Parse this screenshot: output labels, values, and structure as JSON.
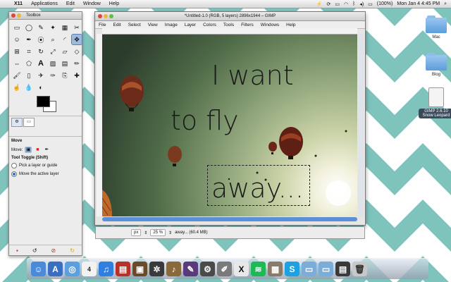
{
  "menubar": {
    "app": "X11",
    "items": [
      "Applications",
      "Edit",
      "Window",
      "Help"
    ],
    "battery": "(100%)",
    "clock": "Mon Jan 4  4:45 PM"
  },
  "toolbox": {
    "title": "Toolbox",
    "tool_options": {
      "heading": "Move",
      "move_label": "Move:",
      "toggle_label": "Tool Toggle  (Shift)",
      "option_pick": "Pick a layer or guide",
      "option_move": "Move the active layer"
    }
  },
  "image_window": {
    "title": "*Untitled-1.0 (RGB, 5 layers) 2896x1944 – GIMP",
    "menu": [
      "File",
      "Edit",
      "Select",
      "View",
      "Image",
      "Layer",
      "Colors",
      "Tools",
      "Filters",
      "Windows",
      "Help"
    ],
    "canvas_text": {
      "line1": "I want",
      "line2": "to fly",
      "line3": "away..."
    },
    "status": {
      "unit": "px",
      "zoom": "25 %",
      "info": "away... (60.4 MB)"
    }
  },
  "desktop_icons": [
    {
      "label": "Mac"
    },
    {
      "label": "Blog"
    },
    {
      "label": "GIMP 2.6.10 Snow Leopard"
    }
  ],
  "colors": {
    "wallpaper_stripe": "#7fc3bd",
    "wallpaper_bg": "#ffffff",
    "accent": "#5b8fd8"
  }
}
